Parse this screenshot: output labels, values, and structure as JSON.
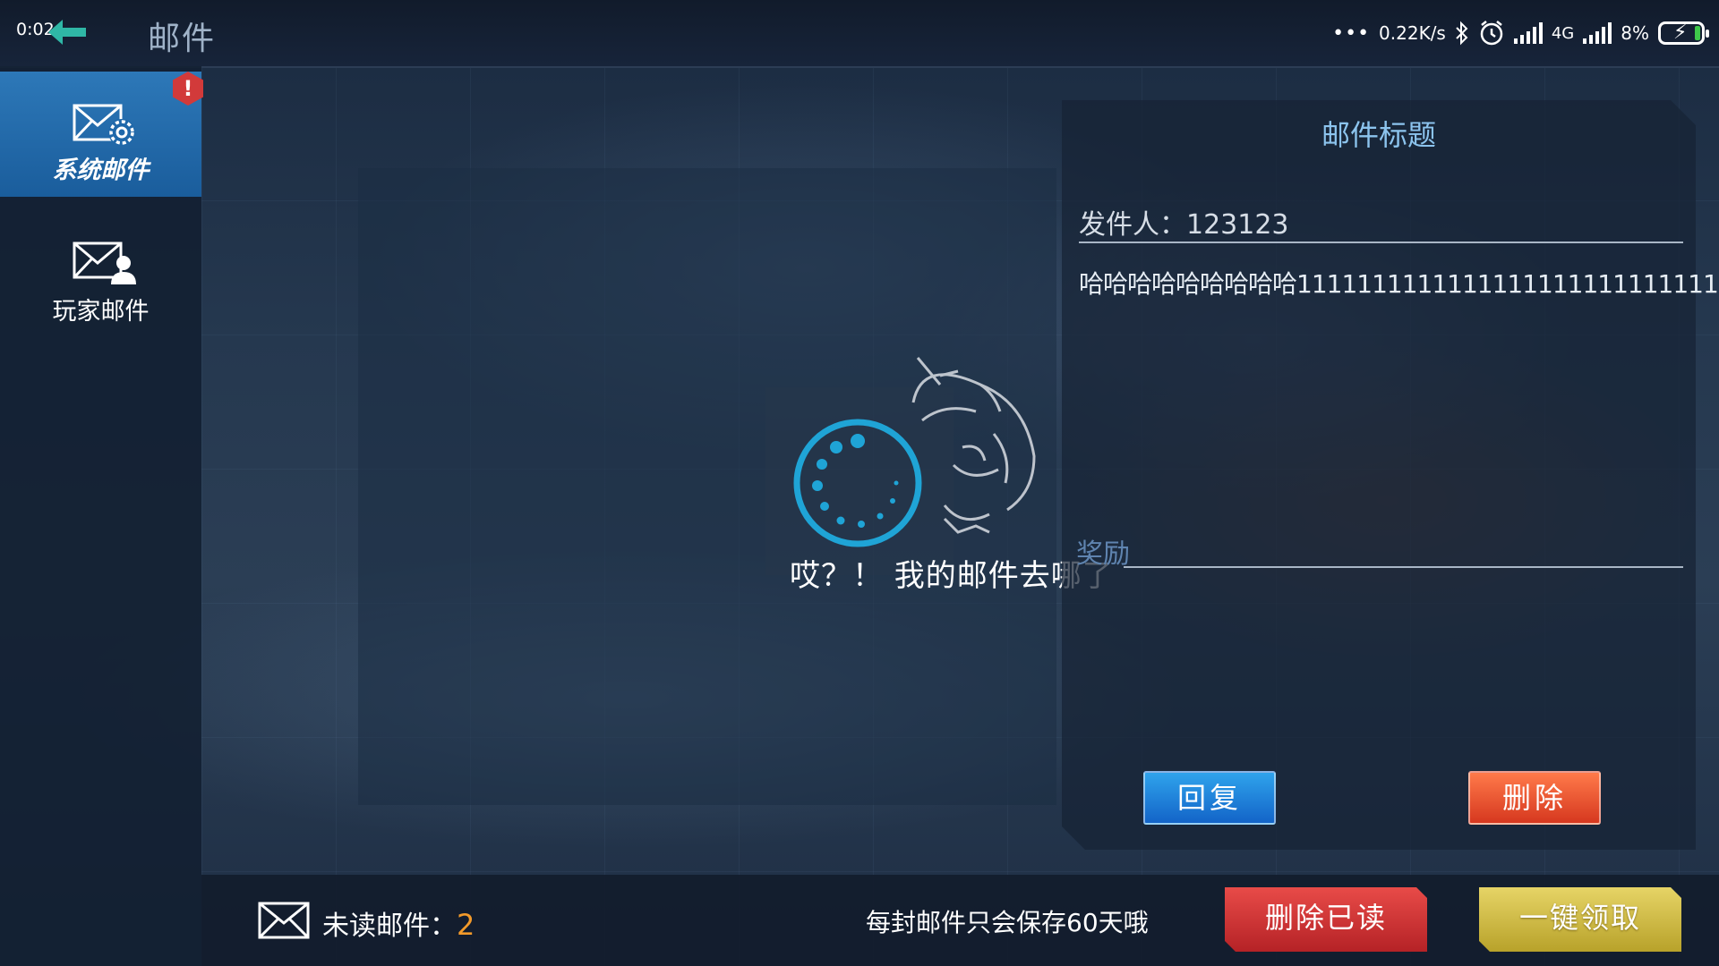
{
  "statusbar": {
    "time": "0:02",
    "net_speed": "0.22K/s",
    "network_type": "4G",
    "battery": "8%",
    "battery_level": 0.08
  },
  "header": {
    "title": "邮件"
  },
  "sidebar": {
    "badge": "!",
    "items": [
      {
        "label": "系统邮件",
        "icon": "system-mail-icon",
        "active": true
      },
      {
        "label": "玩家邮件",
        "icon": "player-mail-icon",
        "active": false
      }
    ]
  },
  "empty_state": {
    "text": "哎？！ 我的邮件去哪了"
  },
  "mail_detail": {
    "title": "邮件标题",
    "sender": "发件人：123123",
    "body": "哈哈哈哈哈哈哈哈哈1111111111111111111111111111",
    "reward_label": "奖励",
    "reply_button": "回复",
    "delete_button": "删除"
  },
  "footer": {
    "unread_label": "未读邮件：",
    "unread_count": "2",
    "keep_note": "每封邮件只会保存60天哦",
    "delete_read_button": "删除已读",
    "claim_all_button": "一键领取"
  },
  "colors": {
    "accent_blue": "#2d78b8",
    "title_blue": "#8cc4ee",
    "unread_count": "#f39a2a",
    "delete_red": "#d6381f",
    "claim_gold": "#c8b640"
  }
}
